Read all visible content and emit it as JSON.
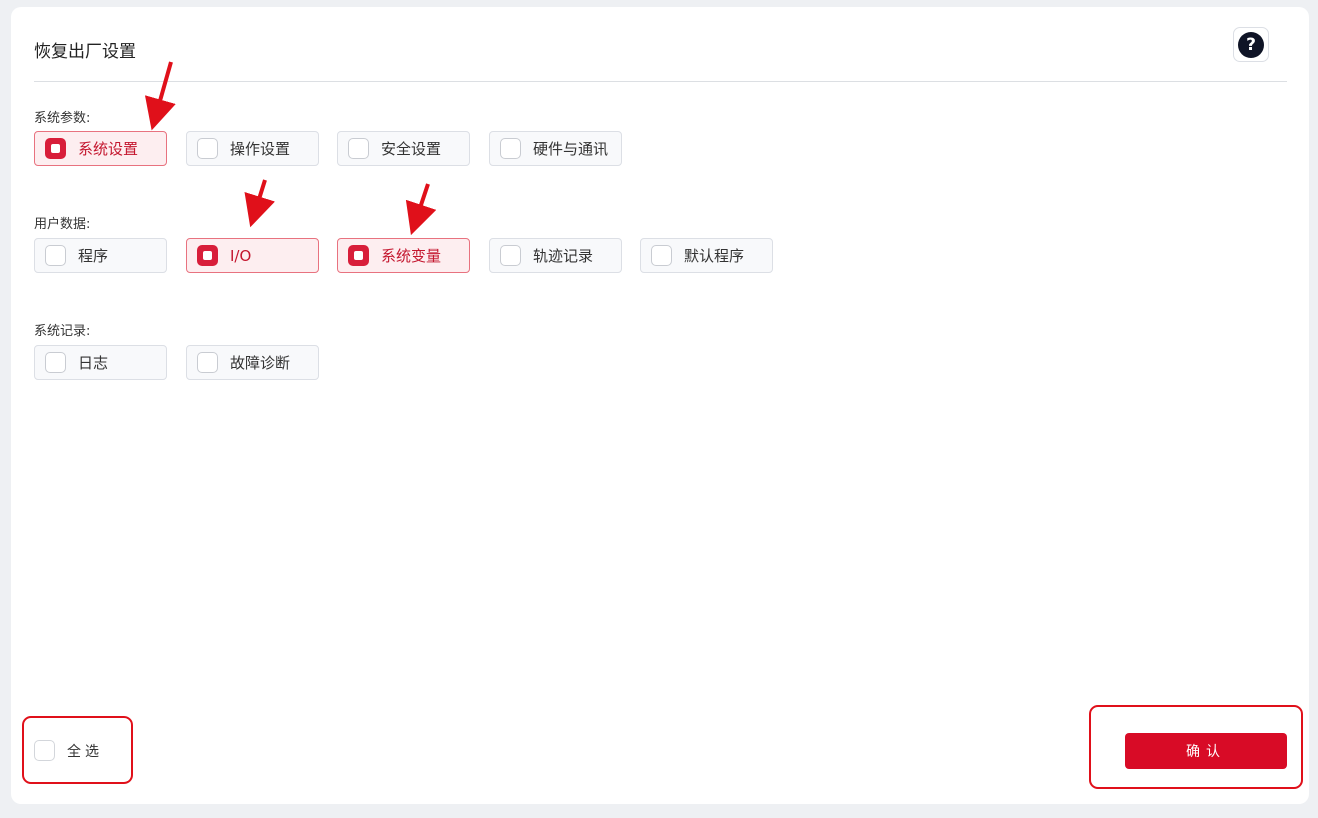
{
  "page": {
    "title": "恢复出厂设置",
    "help_glyph": "?"
  },
  "sections": [
    {
      "label": "系统参数:",
      "options": [
        {
          "label": "系统设置",
          "checked": true
        },
        {
          "label": "操作设置",
          "checked": false
        },
        {
          "label": "安全设置",
          "checked": false
        },
        {
          "label": "硬件与通讯",
          "checked": false
        }
      ]
    },
    {
      "label": "用户数据:",
      "options": [
        {
          "label": "程序",
          "checked": false
        },
        {
          "label": "I/O",
          "checked": true
        },
        {
          "label": "系统变量",
          "checked": true
        },
        {
          "label": "轨迹记录",
          "checked": false
        },
        {
          "label": "默认程序",
          "checked": false
        }
      ]
    },
    {
      "label": "系统记录:",
      "options": [
        {
          "label": "日志",
          "checked": false
        },
        {
          "label": "故障诊断",
          "checked": false
        }
      ]
    }
  ],
  "footer": {
    "select_all_label": "全选",
    "select_all_checked": false,
    "confirm_label": "确认"
  },
  "colors": {
    "accent": "#d80b26",
    "annotation": "#e0101a"
  }
}
